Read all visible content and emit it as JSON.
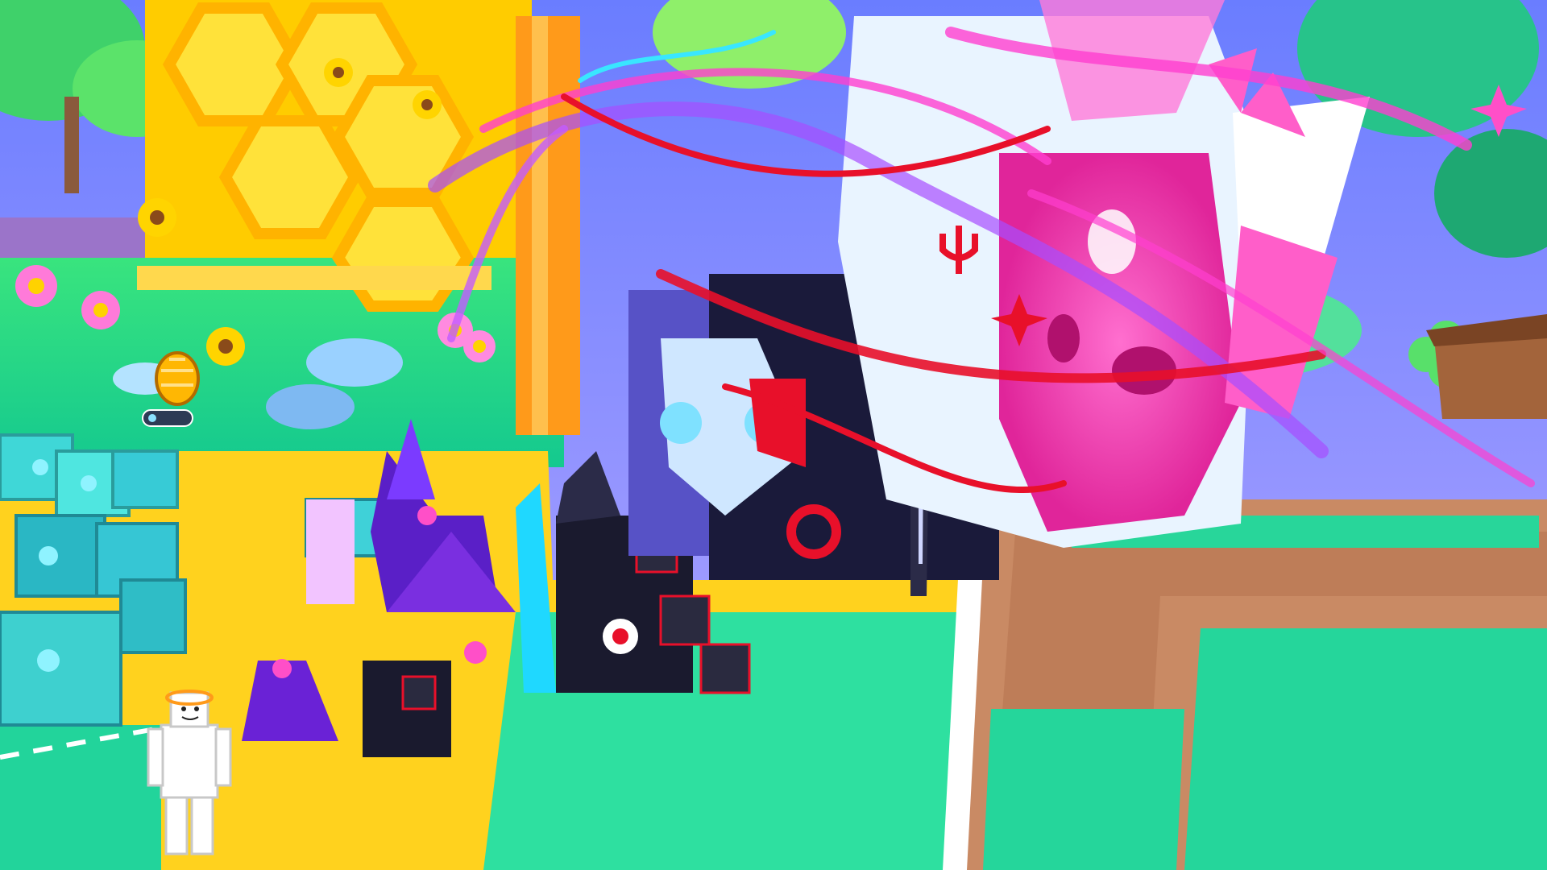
{
  "scene": {
    "title": "",
    "colors": {
      "sky": "#5fd6ff",
      "grass": "#25e08f",
      "path": "#ffd21e",
      "dirt": "#c98a64",
      "honeycomb": "#ffd000",
      "pet_dark": "#1a1a2e",
      "pet_purple": "#6a22d6",
      "accent_pink": "#ff4fc8",
      "accent_red": "#e8102a"
    }
  },
  "hud": {
    "egg_indicator": {
      "label": ""
    },
    "player_shirt_text": ""
  },
  "icons": [
    "honey-egg-icon",
    "flower-icon",
    "clover-icon",
    "star-icon",
    "trident-icon",
    "sword-icon"
  ]
}
